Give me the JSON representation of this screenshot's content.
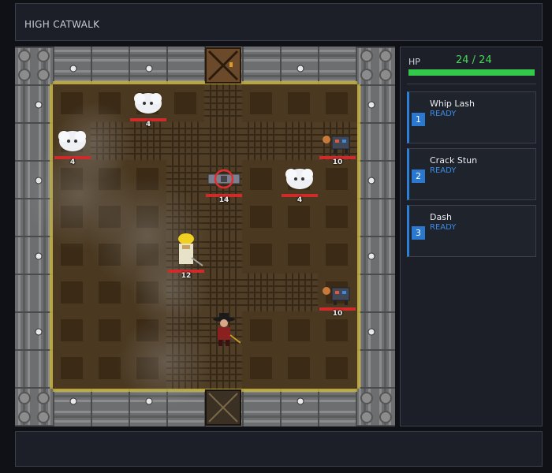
{
  "header": {
    "title": "HIGH CATWALK"
  },
  "player_stats": {
    "hp_label": "HP",
    "hp_text": "24 / 24",
    "hp_fraction": 1.0
  },
  "abilities": [
    {
      "hotkey": "1",
      "name": "Whip Lash",
      "status": "READY"
    },
    {
      "hotkey": "2",
      "name": "Crack Stun",
      "status": "READY"
    },
    {
      "hotkey": "3",
      "name": "Dash",
      "status": "READY"
    }
  ],
  "units": [
    {
      "kind": "sheep",
      "hp": "4"
    },
    {
      "kind": "sheep",
      "hp": "4"
    },
    {
      "kind": "robot",
      "hp": "10"
    },
    {
      "kind": "turret",
      "hp": "14"
    },
    {
      "kind": "sheep",
      "hp": "4"
    },
    {
      "kind": "miner",
      "hp": "12"
    },
    {
      "kind": "robot",
      "hp": "10"
    },
    {
      "kind": "player",
      "hp": ""
    }
  ],
  "colors": {
    "accent": "#2e7fd6",
    "hp_green": "#34c94b",
    "enemy_hp": "#d02a2a"
  }
}
